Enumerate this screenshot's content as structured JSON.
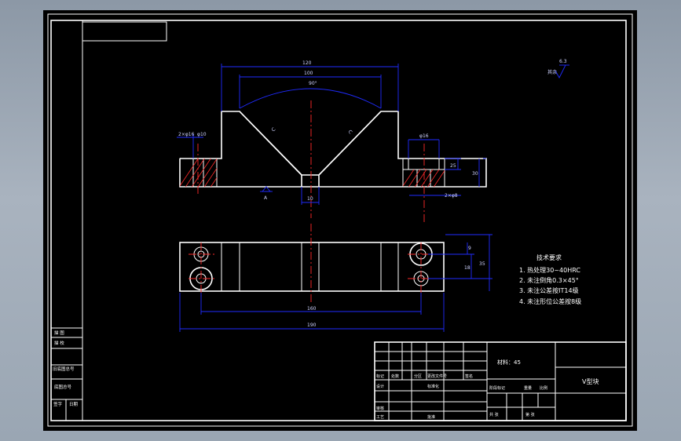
{
  "drawing": {
    "part_name": "V型块",
    "material_label": "材料：45",
    "tech_title": "技术要求",
    "tech_notes": [
      "1. 热处理30~40HRC",
      "2. 未注倒角0.3×45°",
      "3. 未注公差按IT14级",
      "4. 未注形位公差按8级"
    ],
    "surface_finish": "6.3",
    "surface_note": "其余",
    "dims": {
      "overall_top": "120",
      "inner_top": "100",
      "v_angle": "90°",
      "left_hole": "φ10",
      "left_depth": "2×φ16",
      "right_hole": "φ16",
      "right_depth": "2×φ8",
      "right_small": "25",
      "right_height": "30",
      "bottom_slot": "10",
      "datum_left": "A",
      "plan_width": "160",
      "plan_overall": "190",
      "plan_h1": "9",
      "plan_h2": "18",
      "plan_h3": "35"
    },
    "signature_rows": [
      "描 图",
      "描 校",
      "旧底图总号",
      "底图总号",
      "签字",
      "日期"
    ],
    "title_block": {
      "row_label_1": "标记",
      "row_label_2": "设计",
      "row_label_3": "审核",
      "row_label_4": "工艺",
      "row_label_5": "批准",
      "cell_a": "处数",
      "cell_b": "分区",
      "cell_c": "更改文件号",
      "cell_d": "签名",
      "cell_e": "年月日",
      "cell_f": "标准化",
      "stage_label": "阶段标记",
      "weight": "重量",
      "ratio": "比例",
      "sheet": "共 张",
      "sheet2": "第 张"
    }
  }
}
